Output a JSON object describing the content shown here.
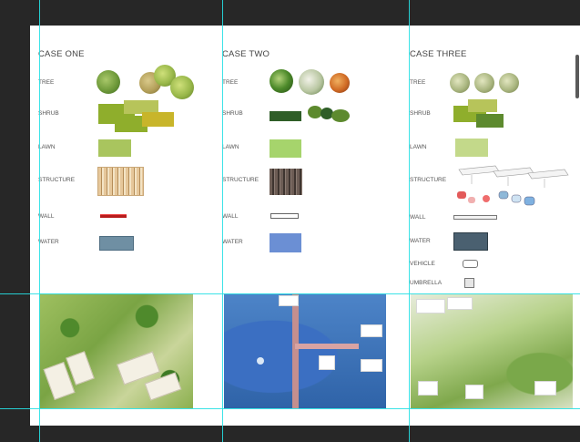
{
  "cases": [
    {
      "title": "CASE ONE",
      "labels": {
        "tree": "TREE",
        "shrub": "SHRUB",
        "lawn": "LAWN",
        "structure": "STRUCTURE",
        "wall": "WALL",
        "water": "WATER"
      }
    },
    {
      "title": "CASE TWO",
      "labels": {
        "tree": "TREE",
        "shrub": "SHRUB",
        "lawn": "LAWN",
        "structure": "STRUCTURE",
        "wall": "WALL",
        "water": "WATER"
      }
    },
    {
      "title": "CASE THREE",
      "labels": {
        "tree": "TREE",
        "shrub": "SHRUB",
        "lawn": "LAWN",
        "structure": "STRUCTURE",
        "wall": "WALL",
        "water": "WATER",
        "vehicle": "VEHICLE",
        "umbrella": "UMBRELLA"
      }
    }
  ],
  "colors": {
    "guide": "#27e0e4",
    "workspace": "#272727",
    "canvas": "#ffffff",
    "wall_case_one": "#b71c1c",
    "water_case_one": "#6f8fa3",
    "water_case_two": "#6b8fd4",
    "water_case_three": "#4a6070"
  }
}
